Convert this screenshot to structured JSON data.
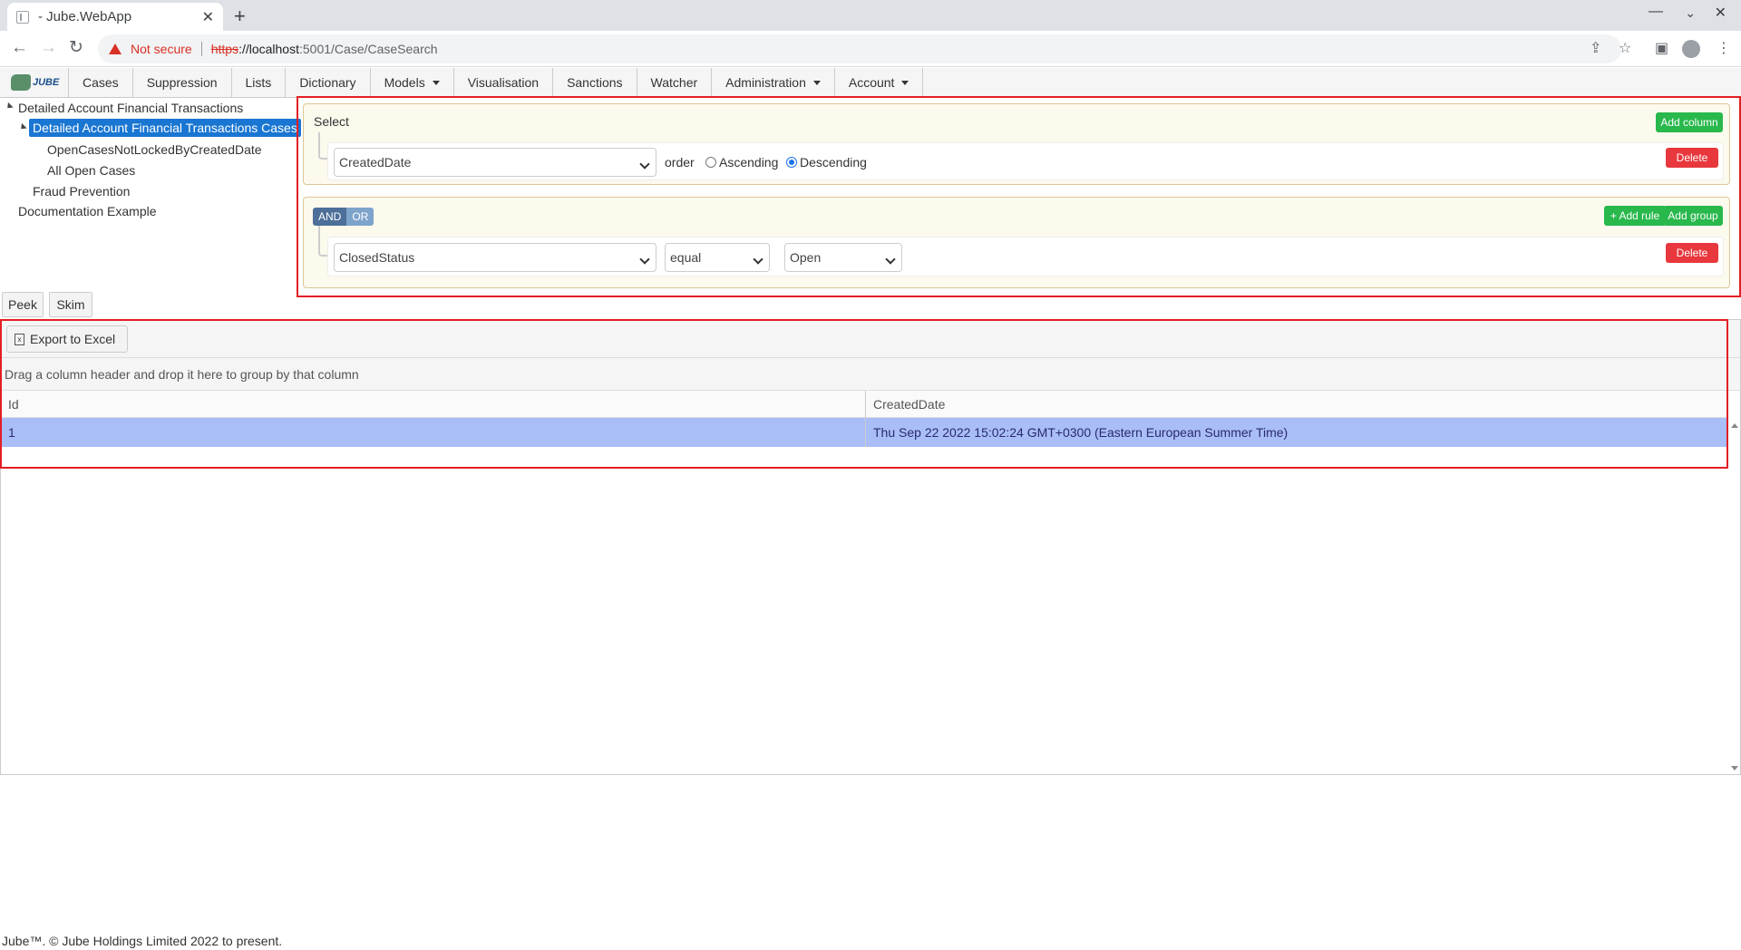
{
  "browser": {
    "tab_title": "- Jube.WebApp",
    "tab_close": "✕",
    "new_tab": "+",
    "security_label": "Not secure",
    "url_scheme": "https",
    "url_host": "://localhost",
    "url_path": ":5001/Case/CaseSearch"
  },
  "app": {
    "logo_text": "JUBE",
    "menu": [
      {
        "label": "Cases"
      },
      {
        "label": "Suppression"
      },
      {
        "label": "Lists"
      },
      {
        "label": "Dictionary"
      },
      {
        "label": "Models",
        "dropdown": true
      },
      {
        "label": "Visualisation"
      },
      {
        "label": "Sanctions"
      },
      {
        "label": "Watcher"
      },
      {
        "label": "Administration",
        "dropdown": true
      },
      {
        "label": "Account",
        "dropdown": true
      }
    ]
  },
  "tree": {
    "root": "Detailed Account Financial Transactions",
    "selected": "Detailed Account Financial Transactions Cases",
    "children": [
      "OpenCasesNotLockedByCreatedDate",
      "All Open Cases"
    ],
    "other": [
      "Fraud Prevention",
      "Documentation Example"
    ]
  },
  "select_group": {
    "title": "Select",
    "add_column_label": "Add column",
    "column_value": "CreatedDate",
    "order_label": "order",
    "ascending_label": "Ascending",
    "descending_label": "Descending",
    "order_selected": "Descending",
    "delete_label": "Delete"
  },
  "filter_group": {
    "and_label": "AND",
    "or_label": "OR",
    "add_rule_label": "+ Add rule",
    "add_group_label": "Add group",
    "field_value": "ClosedStatus",
    "operator_value": "equal",
    "value_value": "Open",
    "delete_label": "Delete"
  },
  "actions": {
    "peek_label": "Peek",
    "skim_label": "Skim"
  },
  "grid": {
    "export_label": "Export to Excel",
    "group_hint": "Drag a column header and drop it here to group by that column",
    "columns": [
      "Id",
      "CreatedDate"
    ],
    "rows": [
      {
        "id": "1",
        "created_date": "Thu Sep 22 2022 15:02:24 GMT+0300 (Eastern European Summer Time)"
      }
    ]
  },
  "footer": {
    "text": "Jube™. © Jube Holdings Limited 2022 to present."
  }
}
